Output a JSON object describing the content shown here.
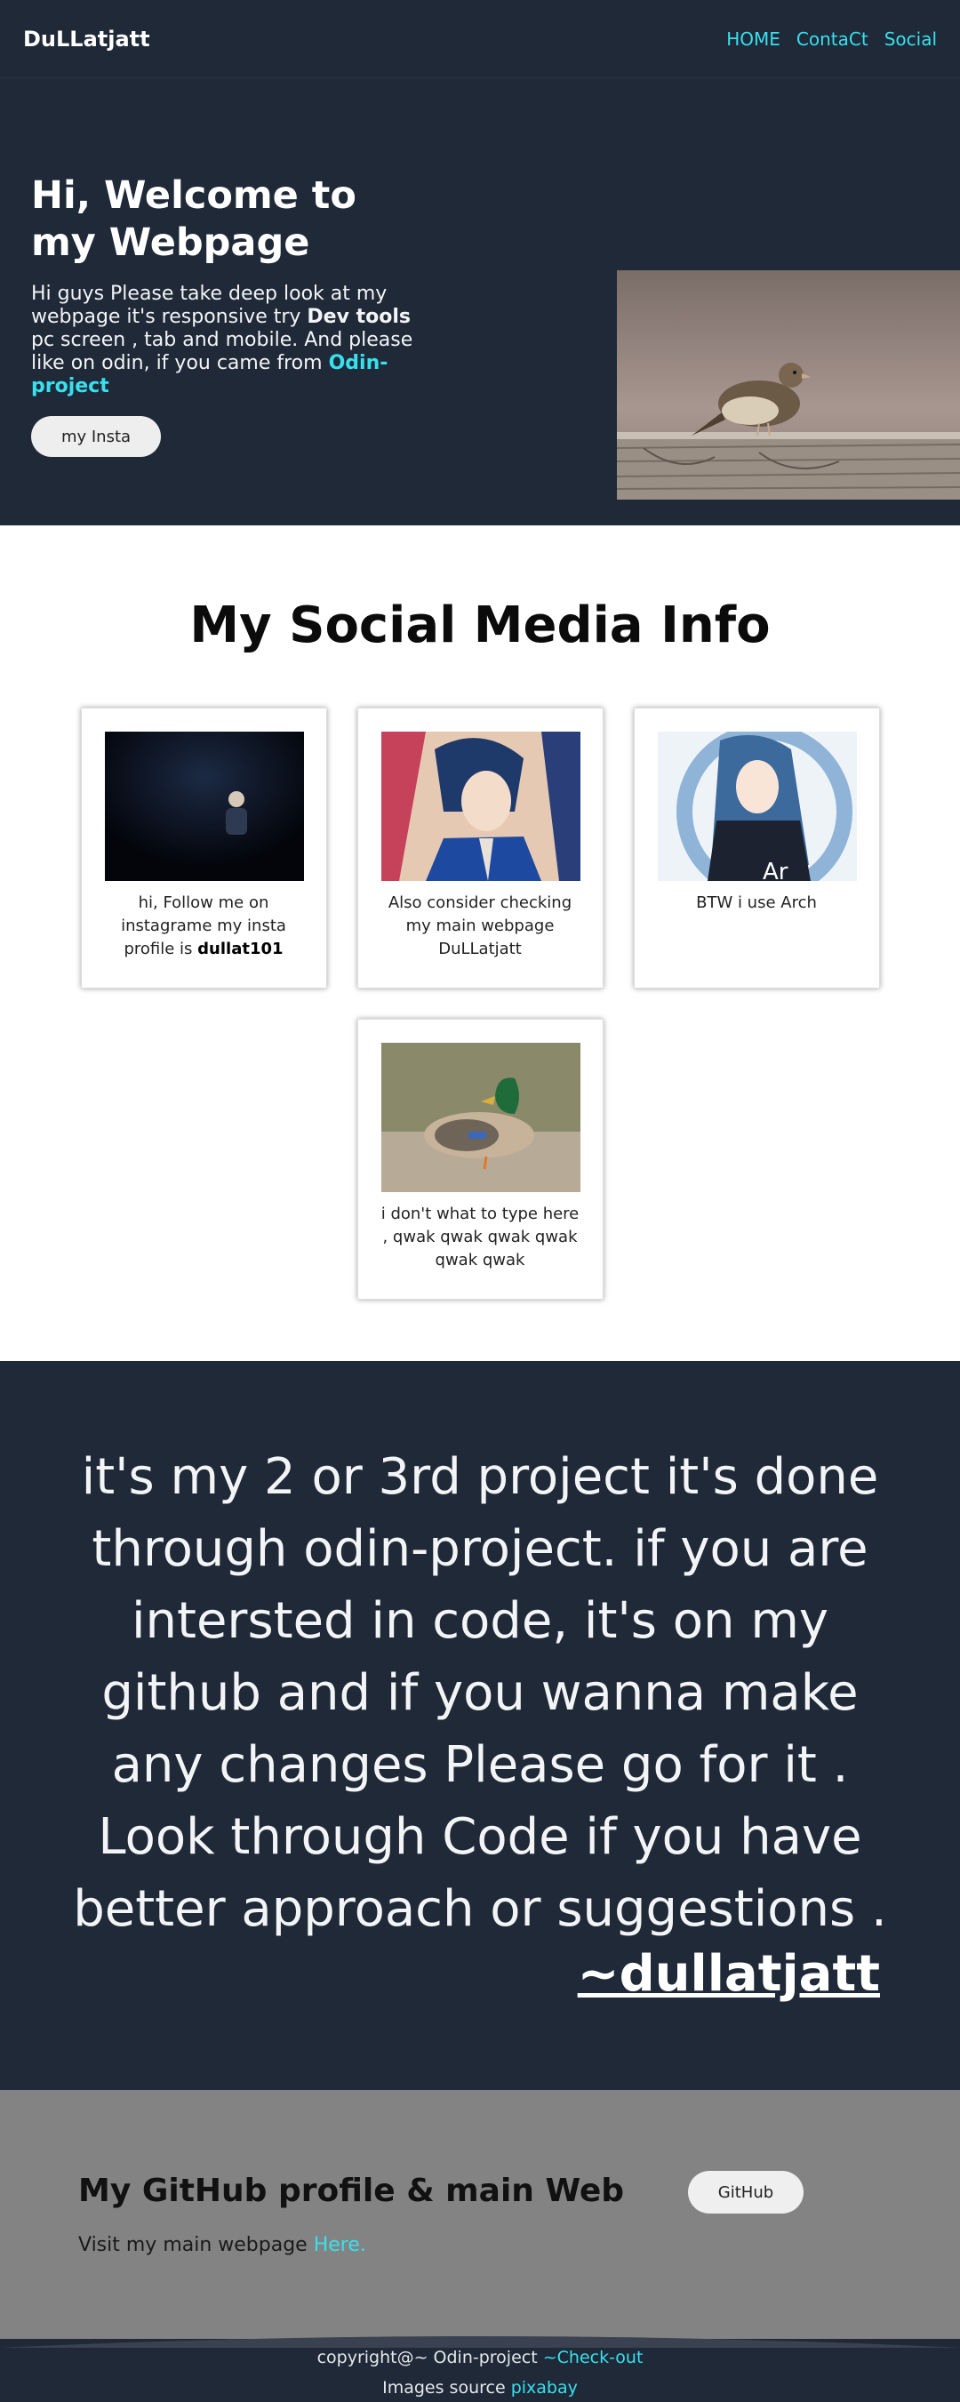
{
  "nav": {
    "brand": "DuLLatjatt",
    "links": [
      "HOME",
      "ContaCt",
      "Social"
    ]
  },
  "hero": {
    "title": "Hi, Welcome to my Webpage",
    "desc_part1": "Hi guys Please take deep look at my webpage it's responsive try ",
    "desc_bold": "Dev tools",
    "desc_part2": " pc screen , tab and mobile. And please like on odin, if you came from ",
    "desc_link": "Odin-project",
    "button": "my Insta"
  },
  "social": {
    "title": "My Social Media Info",
    "cards": [
      {
        "text": "hi, Follow me on instagrame my insta profile is ",
        "bold": "dullat101"
      },
      {
        "text": "Also consider checking my main webpage DuLLatjatt",
        "bold": ""
      },
      {
        "text": "BTW i use Arch",
        "bold": ""
      },
      {
        "text": "i don't what to type here , qwak qwak qwak qwak qwak qwak",
        "bold": ""
      }
    ]
  },
  "quote": {
    "text": "it's my 2 or 3rd project it's done through odin-project. if you are intersted in code, it's on my github and if you wanna make any changes Please go for it . Look through Code if you have better approach or suggestions .",
    "author": "~dullatjatt"
  },
  "github": {
    "title": "My GitHub profile & main Web",
    "sub": "Visit my main webpage ",
    "sub_link": "Here.",
    "button": "GitHub"
  },
  "footer": {
    "line1": "copyright@~ Odin-project ",
    "line1_link": "~Check-out",
    "line2": "Images source ",
    "line2_link": "pixabay"
  },
  "colors": {
    "dark_bg": "#1f2937",
    "accent": "#38e0ee",
    "gray_section": "#838383"
  }
}
